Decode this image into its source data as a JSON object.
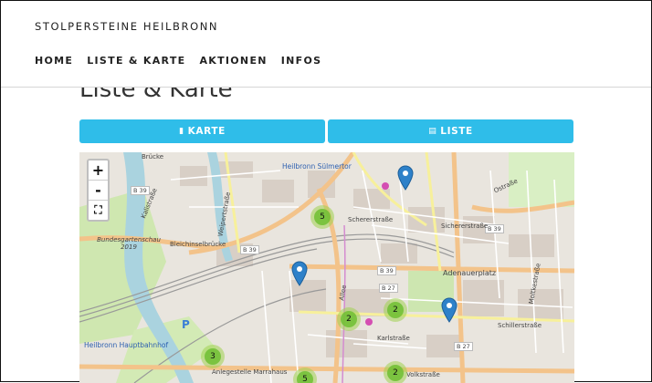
{
  "site": {
    "title": "STOLPERSTEINE HEILBRONN"
  },
  "nav": {
    "items": [
      "HOME",
      "LISTE & KARTE",
      "AKTIONEN",
      "INFOS"
    ]
  },
  "page": {
    "title": "Liste & Karte"
  },
  "buttons": {
    "karte": "KARTE",
    "liste": "LISTE",
    "karte_icon": "map-icon",
    "liste_icon": "list-icon"
  },
  "accent_color": "#2fbde9",
  "map": {
    "zoom_in": "+",
    "zoom_out": "-",
    "fullscreen": "⛶",
    "clusters": [
      "5",
      "2",
      "2",
      "3",
      "2",
      "5"
    ],
    "markers": 3,
    "labels": {
      "bruecke": "Brücke",
      "suelmertor": "Heilbronn Sülmertor",
      "kalistrasse": "Kalistraße",
      "weipertstrasse": "Weipertstraße",
      "b39_a": "B 39",
      "b39_b": "B 39",
      "b39_c": "B 39",
      "b39_d": "B 39",
      "b27_a": "B 27",
      "b27_b": "B 27",
      "buga": "Bundesgartenschau 2019",
      "bleichinselbruecke": "Bleichinselbrücke",
      "hauptbahnhof": "Heilbronn Hauptbahnhof",
      "adenauerplatz": "Adenauerplatz",
      "karlstrasse": "Karlstraße",
      "anlegestelle": "Anlegestelle Marrahaus",
      "schererstrasse": "Schererstraße",
      "sichererstrasse": "Sichererstraße",
      "ostrasse": "Ostraße",
      "schillerstrasse": "Schillerstraße",
      "volkstrasse": "Volkstraße",
      "allee": "Allee",
      "moltkestrasse": "Moltkestraße"
    }
  }
}
